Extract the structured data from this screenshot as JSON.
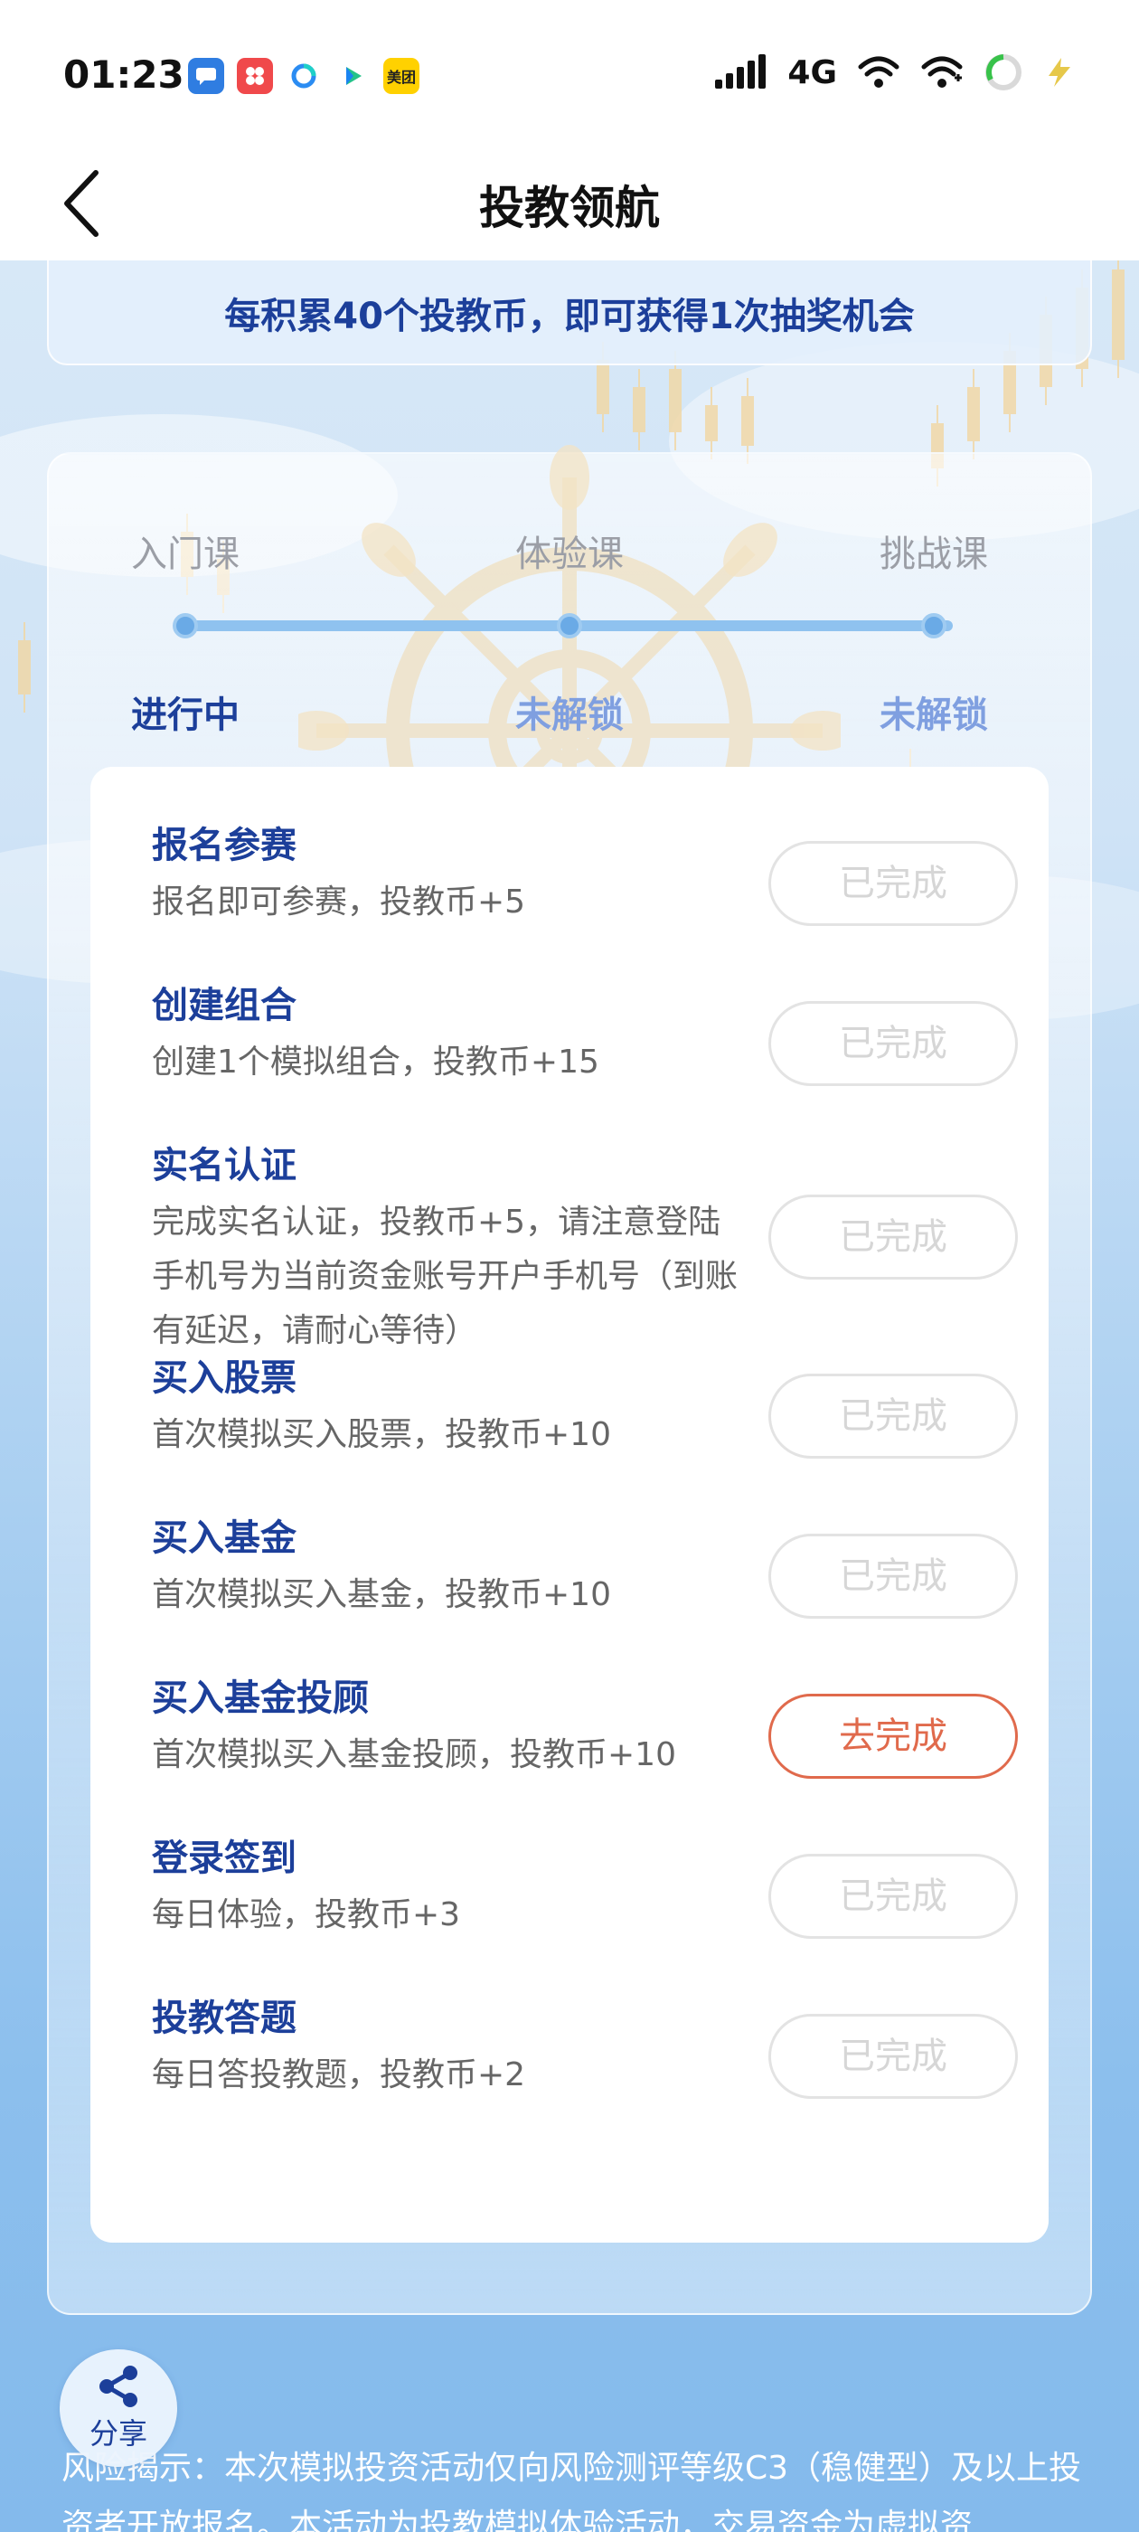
{
  "status_bar": {
    "time": "01:23",
    "network": "4G",
    "apps": [
      "chat-app-icon",
      "photo-app-icon",
      "browser-app-icon",
      "video-app-icon",
      "meituan-app-icon"
    ],
    "meituan_label": "美团"
  },
  "nav": {
    "title": "投教领航"
  },
  "banner": {
    "text": "每积累40个投教币，即可获得1次抽奖机会"
  },
  "progress": {
    "stages": [
      {
        "label": "入门课",
        "status": "进行中",
        "status_color": "#1c3f9a"
      },
      {
        "label": "体验课",
        "status": "未解锁",
        "status_color": "#7f9fe0"
      },
      {
        "label": "挑战课",
        "status": "未解锁",
        "status_color": "#7f9fe0"
      }
    ]
  },
  "tasks": [
    {
      "title": "报名参赛",
      "desc": "报名即可参赛，投教币+5",
      "button": "已完成",
      "active": false
    },
    {
      "title": "创建组合",
      "desc": "创建1个模拟组合，投教币+15",
      "button": "已完成",
      "active": false
    },
    {
      "title": "实名认证",
      "desc": "完成实名认证，投教币+5，请注意登陆手机号为当前资金账号开户手机号（到账有延迟，请耐心等待）",
      "button": "已完成",
      "active": false
    },
    {
      "title": "买入股票",
      "desc": "首次模拟买入股票，投教币+10",
      "button": "已完成",
      "active": false
    },
    {
      "title": "买入基金",
      "desc": "首次模拟买入基金，投教币+10",
      "button": "已完成",
      "active": false
    },
    {
      "title": "买入基金投顾",
      "desc": "首次模拟买入基金投顾，投教币+10",
      "button": "去完成",
      "active": true
    },
    {
      "title": "登录签到",
      "desc": "每日体验，投教币+3",
      "button": "已完成",
      "active": false
    },
    {
      "title": "投教答题",
      "desc": "每日答投教题，投教币+2",
      "button": "已完成",
      "active": false
    }
  ],
  "share": {
    "label": "分享"
  },
  "risk": {
    "text": "风险揭示：本次模拟投资活动仅向风险测评等级C3（稳健型）及以上投资者开放报名。本活动为投教模拟体验活动，交易资金为虚拟资"
  },
  "colors": {
    "accent": "#1c3f9a",
    "action": "#e06a4c",
    "track": "#8fc2ef"
  }
}
